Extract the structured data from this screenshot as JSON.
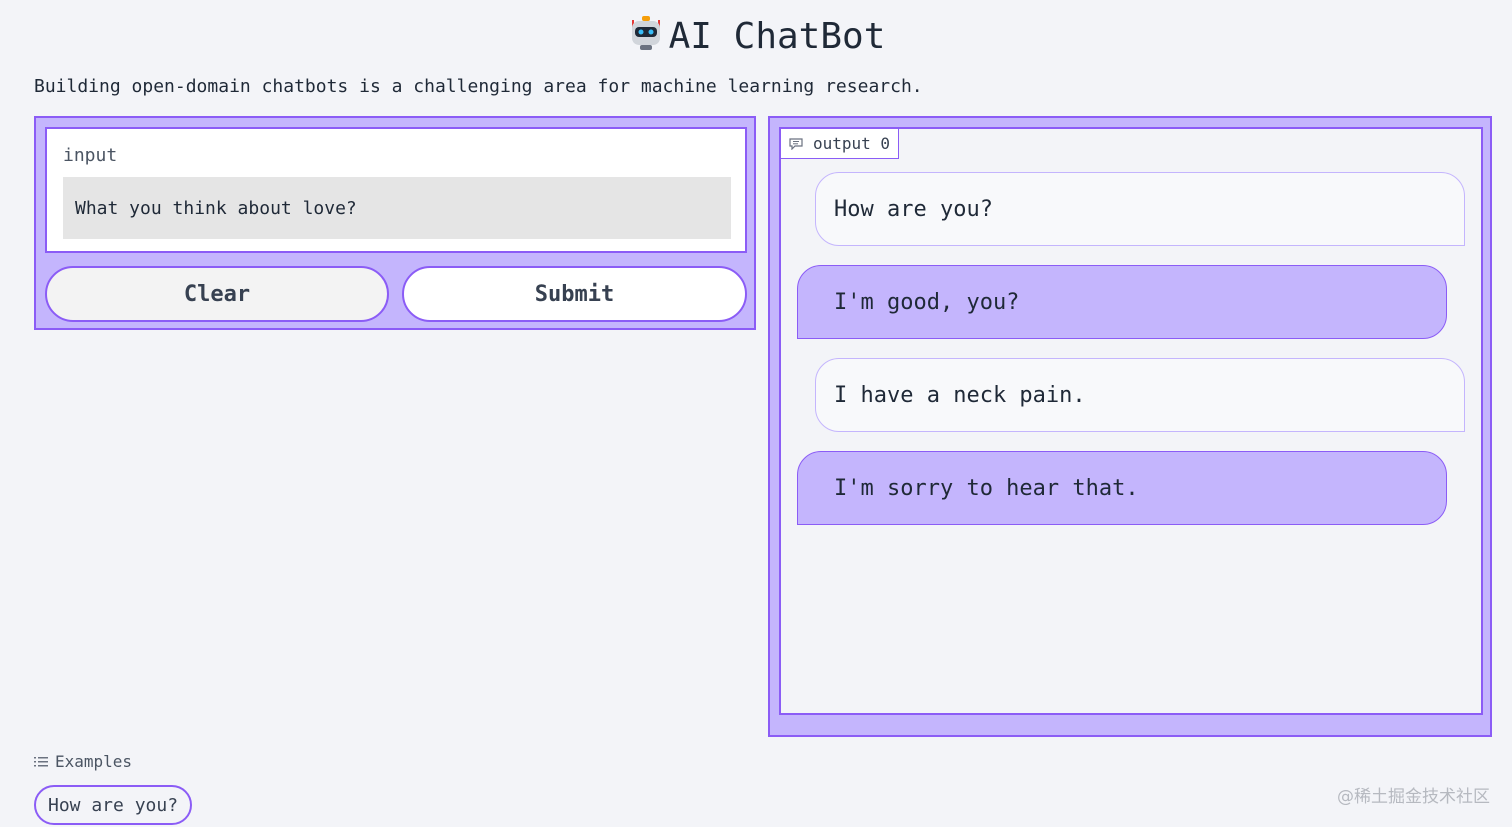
{
  "header": {
    "title": "AI ChatBot",
    "icon": "robot-icon",
    "description": "Building open-domain chatbots is a challenging area for machine learning research."
  },
  "input_panel": {
    "label": "input",
    "value": "What you think about love?",
    "clear_label": "Clear",
    "submit_label": "Submit"
  },
  "output_panel": {
    "label": "output 0",
    "icon": "chat-icon",
    "messages": [
      {
        "role": "user",
        "text": "How are you?"
      },
      {
        "role": "bot",
        "text": "I'm good, you?"
      },
      {
        "role": "user",
        "text": "I have a neck pain."
      },
      {
        "role": "bot",
        "text": "I'm sorry to hear that."
      }
    ]
  },
  "examples": {
    "label": "Examples",
    "icon": "list-icon",
    "items": [
      "How are you?"
    ]
  },
  "watermark": "@稀土掘金技术社区",
  "colors": {
    "accent": "#8b5cf6",
    "accent_light": "#c4b5fd",
    "background": "#f3f4f8"
  }
}
